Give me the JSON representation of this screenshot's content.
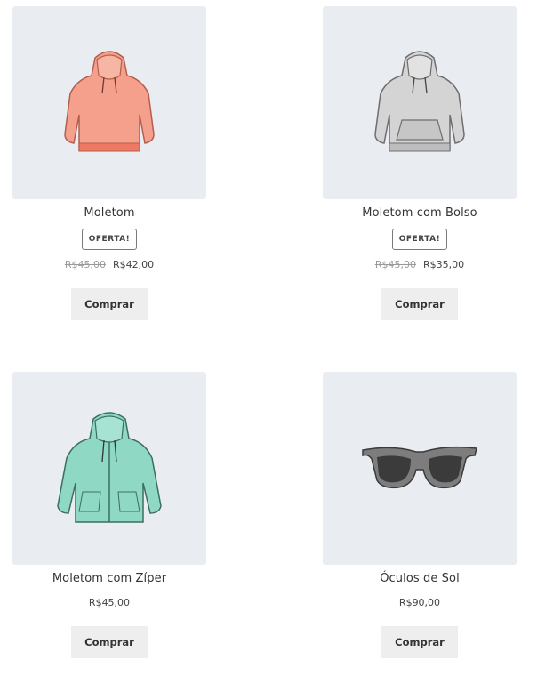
{
  "products": [
    {
      "name": "Moletom",
      "badge": "OFERTA!",
      "old_price": "R$45,00",
      "price": "R$42,00",
      "button": "Comprar",
      "image_icon": "hoodie-coral-icon",
      "color": "#f4a08d"
    },
    {
      "name": "Moletom com Bolso",
      "badge": "OFERTA!",
      "old_price": "R$45,00",
      "price": "R$35,00",
      "button": "Comprar",
      "image_icon": "hoodie-grey-pocket-icon",
      "color": "#cfcfcf"
    },
    {
      "name": "Moletom com Zíper",
      "price": "R$45,00",
      "button": "Comprar",
      "image_icon": "hoodie-mint-zipper-icon",
      "color": "#8fd9c4"
    },
    {
      "name": "Óculos de Sol",
      "price": "R$90,00",
      "button": "Comprar",
      "image_icon": "sunglasses-icon",
      "color": "#555555"
    }
  ]
}
